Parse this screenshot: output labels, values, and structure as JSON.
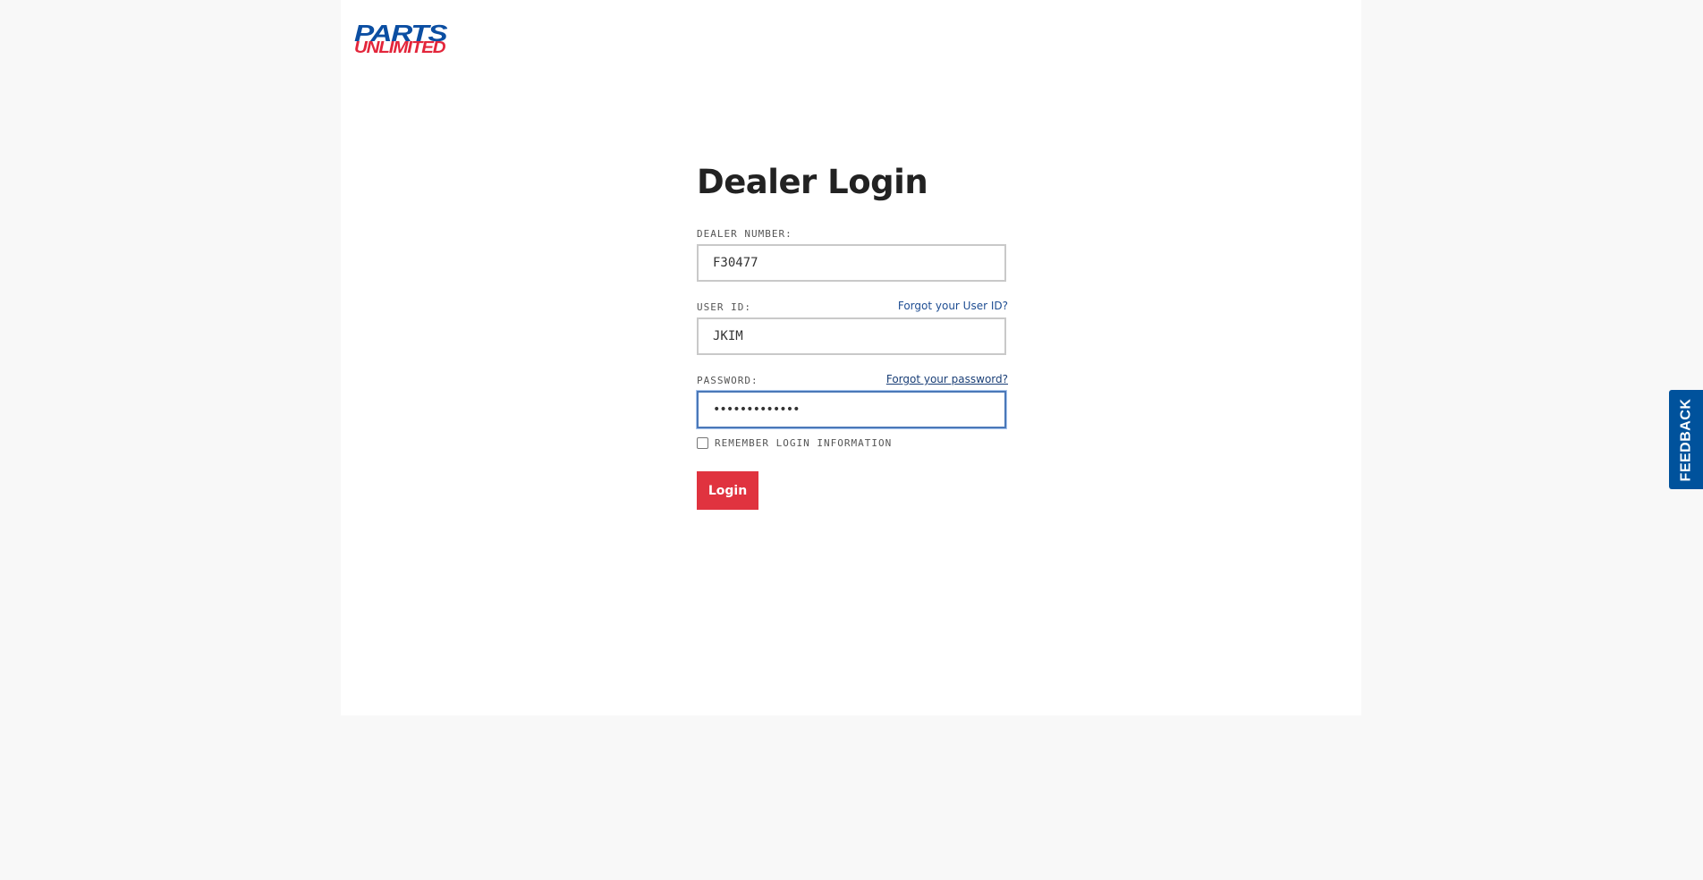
{
  "brand": {
    "logo_top": "PARTS",
    "logo_bottom": "UNLIMITED",
    "colors": {
      "blue": "#0b4ea2",
      "red": "#e3263b"
    }
  },
  "login": {
    "title": "Dealer Login",
    "dealer_number": {
      "label": "DEALER NUMBER:",
      "value": "F30477"
    },
    "user_id": {
      "label": "USER ID:",
      "value": "JKIM",
      "forgot_link": "Forgot your User ID?"
    },
    "password": {
      "label": "PASSWORD:",
      "masked_value": "•••••••••••••",
      "forgot_link": "Forgot your password?"
    },
    "remember": {
      "label": "REMEMBER LOGIN INFORMATION",
      "checked": false
    },
    "submit_label": "Login",
    "submit_color": "#e0333f"
  },
  "feedback": {
    "label": "FEEDBACK",
    "color": "#00529c"
  }
}
